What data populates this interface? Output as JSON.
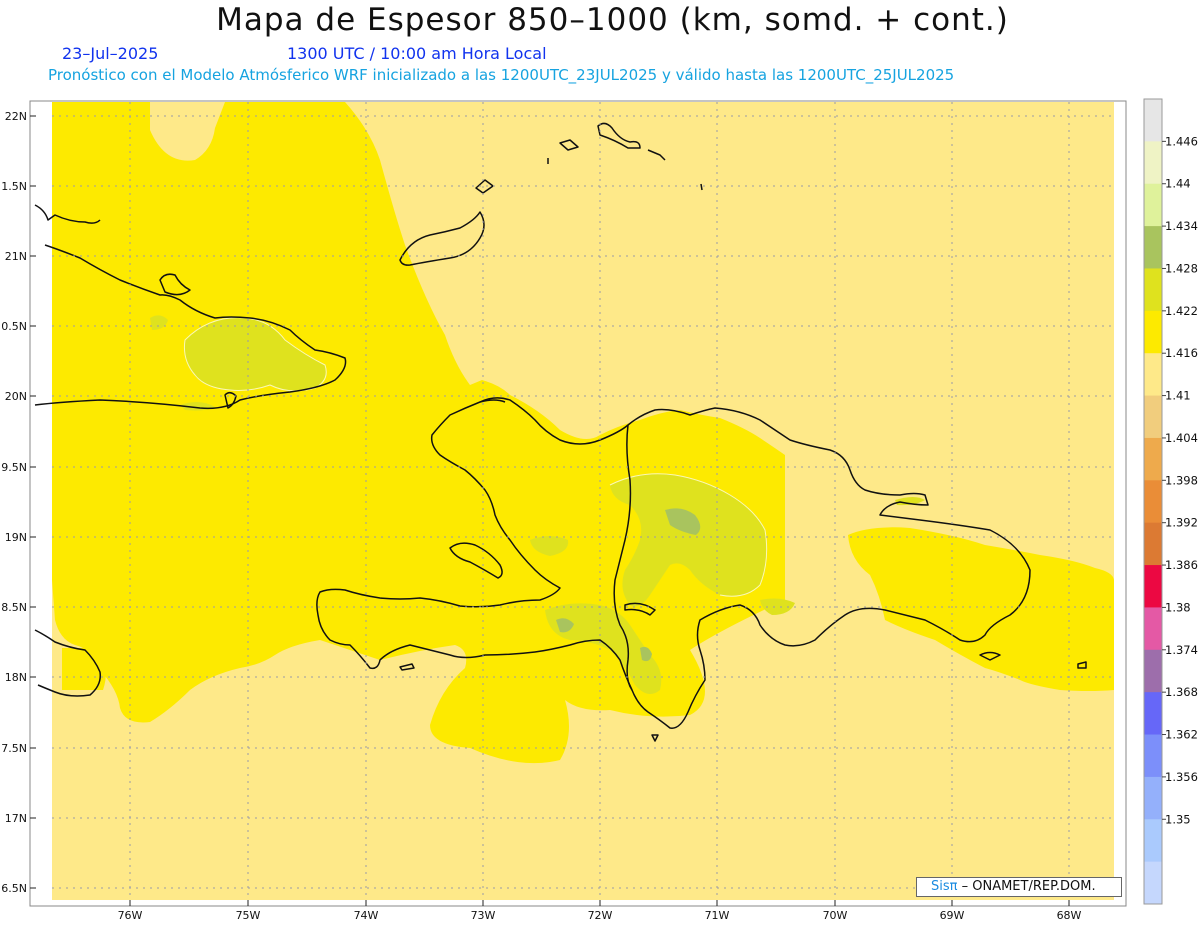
{
  "header": {
    "title": "Mapa de Espesor 850–1000 (km, somd. + cont.)",
    "date": "23–Jul–2025",
    "time": "1300 UTC / 10:00 am Hora Local",
    "forecast": "Pronóstico con el Modelo Atmósferico WRF inicializado a las 1200UTC_23JUL2025 y válido hasta las  1200UTC_25JUL2025"
  },
  "map": {
    "lat_labels": [
      "22N",
      "1.5N",
      "21N",
      "0.5N",
      "20N",
      "9.5N",
      "19N",
      "8.5N",
      "18N",
      "7.5N",
      "17N",
      "6.5N"
    ],
    "lon_labels": [
      "76W",
      "75W",
      "74W",
      "73W",
      "72W",
      "71W",
      "70W",
      "69W",
      "68W"
    ],
    "colors": {
      "background": "#fee989",
      "band_1416": "#fdea00",
      "band_1422": "#dfe21e",
      "band_1428": "#a9c45e",
      "coast": "#111111"
    }
  },
  "colorbar": {
    "labels": [
      "1.446",
      "1.44",
      "1.434",
      "1.428",
      "1.422",
      "1.416",
      "1.41",
      "1.404",
      "1.398",
      "1.392",
      "1.386",
      "1.38",
      "1.374",
      "1.368",
      "1.362",
      "1.356",
      "1.35"
    ],
    "colors": [
      "#e6e6e6",
      "#eff3c5",
      "#dff29b",
      "#a9c45e",
      "#dfe21e",
      "#fdea00",
      "#fee989",
      "#f1cd7d",
      "#eeaa4c",
      "#ea8d37",
      "#dc7a33",
      "#ec0842",
      "#e459a5",
      "#9d6eab",
      "#6667f8",
      "#7c8ffa",
      "#94b0fb",
      "#aacafd",
      "#c5d7fd"
    ]
  },
  "credit": {
    "brand": "Sisπ",
    "text": " – ONAMET/REP.DOM."
  }
}
